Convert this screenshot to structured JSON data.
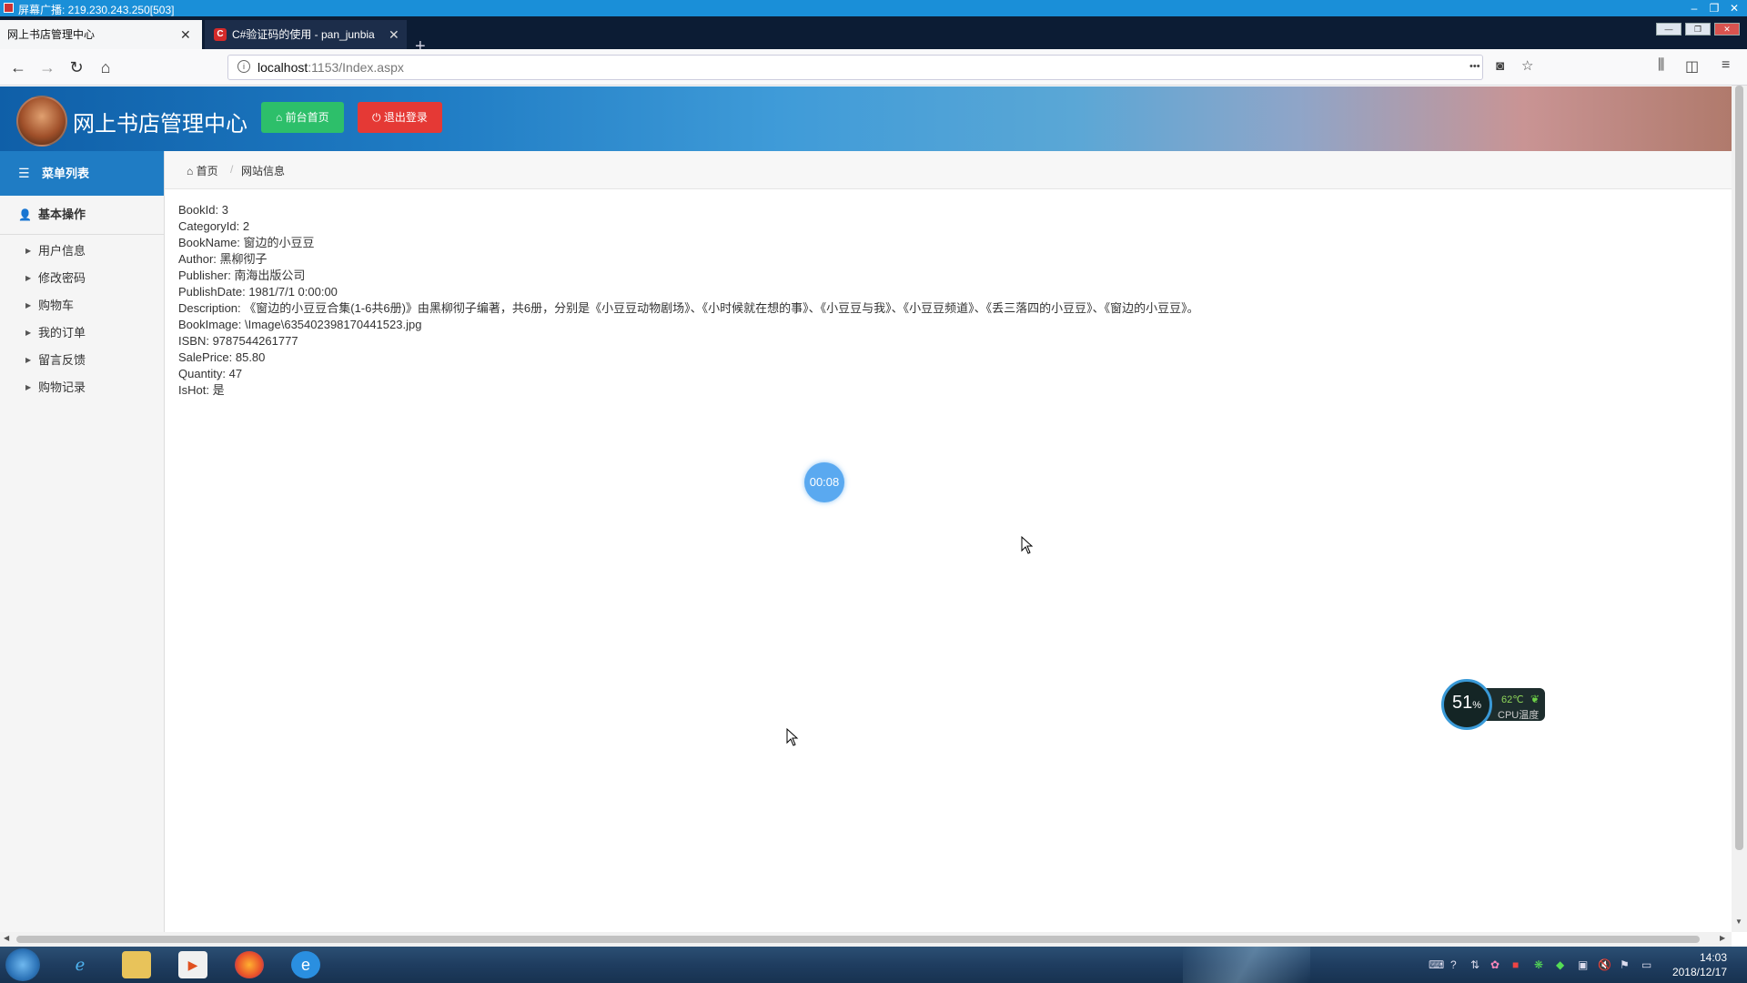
{
  "broadcast": {
    "title": "屏幕广播: 219.230.243.250[503]",
    "minimize": "–",
    "restore": "❐",
    "close": "✕"
  },
  "browser": {
    "tabs": [
      {
        "label": "网上书店管理中心",
        "close": "✕"
      },
      {
        "label": "C#验证码的使用 - pan_junbia",
        "favicon": "C",
        "close": "✕"
      }
    ],
    "new_tab": "+",
    "url_host": "localhost",
    "url_rest": ":1153/Index.aspx",
    "back": "←",
    "forward": "→",
    "reload": "↻",
    "home": "⌂",
    "more": "•••",
    "pocket": "◙",
    "bookmark": "☆",
    "library": "⫼",
    "sidebar_toggle": "◫",
    "menu": "≡",
    "info": "i"
  },
  "header": {
    "title": "网上书店管理中心",
    "home_button": "前台首页",
    "logout_button": "退出登录"
  },
  "sidebar": {
    "heading": "菜单列表",
    "section": "基本操作",
    "items": [
      {
        "label": "用户信息"
      },
      {
        "label": "修改密码"
      },
      {
        "label": "购物车"
      },
      {
        "label": "我的订单"
      },
      {
        "label": "留言反馈"
      },
      {
        "label": "购物记录"
      }
    ]
  },
  "breadcrumb": {
    "home": "首页",
    "separator": "/",
    "current": "网站信息"
  },
  "book": {
    "lines": [
      "BookId: 3",
      "CategoryId: 2",
      "BookName: 窗边的小豆豆",
      "Author: 黑柳彻子",
      "Publisher: 南海出版公司",
      "PublishDate: 1981/7/1 0:00:00",
      "Description: 《窗边的小豆豆合集(1-6共6册)》由黑柳彻子编著，共6册，分别是《小豆豆动物剧场》、《小时候就在想的事》、《小豆豆与我》、《小豆豆频道》、《丢三落四的小豆豆》、《窗边的小豆豆》。",
      "BookImage: \\Image\\635402398170441523.jpg",
      "ISBN: 9787544261777",
      "SalePrice: 85.80",
      "Quantity: 47",
      "IsHot: 是"
    ]
  },
  "timer": "00:08",
  "cpu_widget": {
    "percent": "51",
    "percent_sign": "%",
    "temperature": "62℃",
    "label": "CPU温度"
  },
  "clock": {
    "time": "14:03",
    "date": "2018/12/17"
  },
  "colors": {
    "accent": "#1f7cc4",
    "home_button": "#2dbf6a",
    "logout_button": "#e53935",
    "taskbar": "#1f3d60"
  }
}
